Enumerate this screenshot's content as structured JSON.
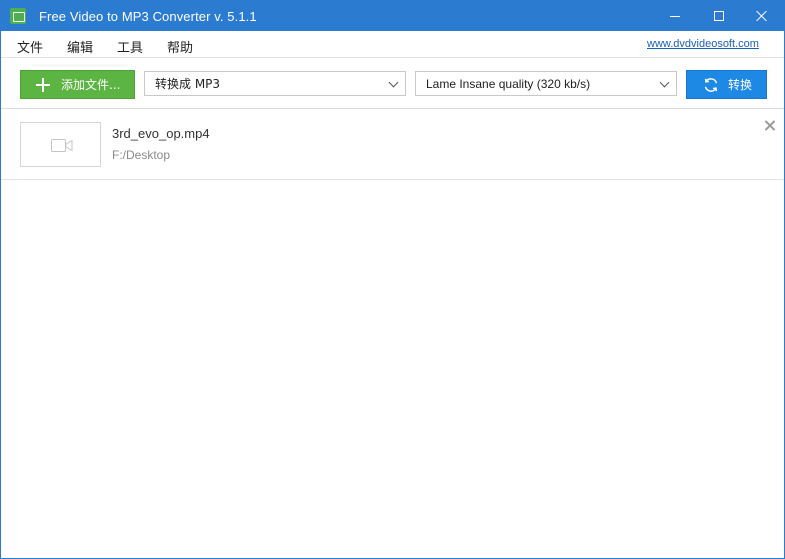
{
  "window": {
    "title": "Free Video to MP3 Converter v. 5.1.1",
    "accent_color": "#2b7bd1",
    "controls": {
      "minimize": "minimize-icon",
      "maximize": "maximize-icon",
      "close": "close-icon"
    }
  },
  "menu": {
    "items": [
      {
        "label": "文件"
      },
      {
        "label": "编辑"
      },
      {
        "label": "工具"
      },
      {
        "label": "帮助"
      }
    ],
    "site_link": "www.dvdvideosoft.com"
  },
  "toolbar": {
    "add_label": "添加文件...",
    "add_color": "#5cb542",
    "format_selected": "转换成 MP3",
    "quality_selected": "Lame Insane quality (320 kb/s)",
    "convert_label": "转换",
    "convert_color": "#1e88e5"
  },
  "files": [
    {
      "name": "3rd_evo_op.mp4",
      "path": "F:/Desktop",
      "thumbnail_icon": "video-camera-icon"
    }
  ]
}
